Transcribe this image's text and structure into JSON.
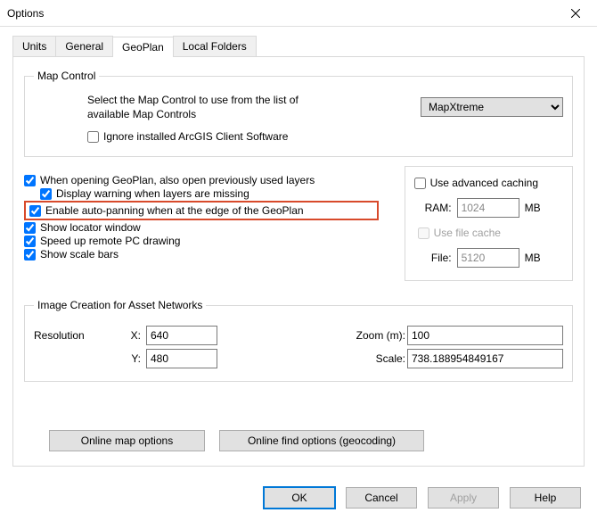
{
  "window": {
    "title": "Options"
  },
  "tabs": {
    "t0": "Units",
    "t1": "General",
    "t2": "GeoPlan",
    "t3": "Local Folders"
  },
  "mapcontrol": {
    "legend": "Map Control",
    "label": "Select the Map Control to use from the list of available Map Controls",
    "selected": "MapXtreme",
    "ignore": "Ignore installed ArcGIS Client Software"
  },
  "checks": {
    "c1": "When opening GeoPlan, also open previously used layers",
    "c2": "Display warning when layers are missing",
    "c3": "Enable auto-panning when at the edge of the GeoPlan",
    "c4": "Show locator window",
    "c5": "Speed up remote PC drawing",
    "c6": "Show scale bars"
  },
  "cache": {
    "adv": "Use advanced caching",
    "ramlabel": "RAM:",
    "ram": "1024",
    "usefile": "Use file cache",
    "filelabel": "File:",
    "file": "5120",
    "unit": "MB"
  },
  "image": {
    "legend": "Image Creation for Asset Networks",
    "reslabel": "Resolution",
    "xlabel": "X:",
    "ylabel": "Y:",
    "x": "640",
    "y": "480",
    "zoomlabel": "Zoom (m):",
    "zoom": "100",
    "scalelabel": "Scale:",
    "scale": "738.188954849167"
  },
  "online": {
    "map": "Online map options",
    "find": "Online find options (geocoding)"
  },
  "footer": {
    "ok": "OK",
    "cancel": "Cancel",
    "apply": "Apply",
    "help": "Help"
  }
}
